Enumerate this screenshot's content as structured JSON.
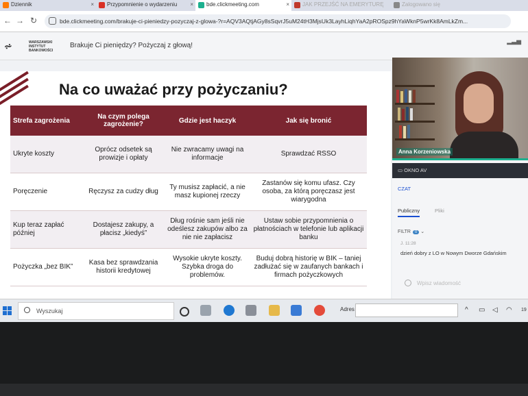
{
  "browser": {
    "tabs": [
      {
        "label": "Dziennik",
        "color": "#ff7a00"
      },
      {
        "label": "Przypomnienie o wydarzeniu",
        "color": "#d93025"
      },
      {
        "label": "bde.clickmeeting.com",
        "color": "#1db08f",
        "active": true
      },
      {
        "label": "JAK PRZEJŚĆ NA EMERYTURĘ",
        "color": "#c0392b"
      },
      {
        "label": "Zalogowano się",
        "color": "#888888"
      }
    ],
    "url": "bde.clickmeeting.com/brakuje-ci-pieniedzy-pozyczaj-z-glowa-?r=AQV3AQtjAGy8sSqvrJ5uM24tH3MjsUk3LayhLiqhYaA2pROSpz9hYaWknP5wrKk8AmLkZm..."
  },
  "meeting": {
    "logo_lines": [
      "WARSZAWSKI",
      "INSTYTUT",
      "BANKOWOŚCI"
    ],
    "title": "Brakuje Ci pieniędzy? Pożyczaj z głową!"
  },
  "slide": {
    "title": "Na co uważać przy pożyczaniu?",
    "headers": [
      "Strefa zagrożenia",
      "Na czym polega zagrożenie?",
      "Gdzie jest haczyk",
      "Jak się bronić"
    ],
    "rows": [
      [
        "Ukryte koszty",
        "Oprócz odsetek są prowizje i opłaty",
        "Nie zwracamy uwagi na informacje",
        "Sprawdzać RSSO"
      ],
      [
        "Poręczenie",
        "Ręczysz za cudzy dług",
        "Ty musisz zapłacić, a nie masz kupionej rzeczy",
        "Zastanów się komu ufasz. Czy osoba, za którą poręczasz jest wiarygodna"
      ],
      [
        "Kup teraz zapłać później",
        "Dostajesz zakupy, a płacisz „kiedyś”",
        "Dług rośnie sam jeśli nie odeślesz zakupów albo za nie nie zapłacisz",
        "Ustaw sobie przypomnienia o płatnościach w telefonie lub aplikacji banku"
      ],
      [
        "Pożyczka „bez BIK”",
        "Kasa bez sprawdzania historii kredytowej",
        "Wysokie ukryte koszty. Szybka droga do problemów.",
        "Buduj dobrą historię w BIK – taniej zadłużać się w zaufanych bankach i firmach pożyczkowych"
      ]
    ]
  },
  "panel": {
    "presenter_name": "Anna Korzeniowska",
    "okno_av": "OKNO AV",
    "czat": "CZAT",
    "tab_public": "Publiczny",
    "tab_files": "Pliki",
    "filtr": "FILTR",
    "filtr_count": "0",
    "message_time": "J. 11:28",
    "message_text": "dzień dobry z LO w  Nowym Dworze Gdańskim",
    "input_placeholder": "Wpisz wiadomość"
  },
  "taskbar": {
    "search_placeholder": "Wyszukaj",
    "adres_label": "Adres",
    "clock": "19"
  }
}
